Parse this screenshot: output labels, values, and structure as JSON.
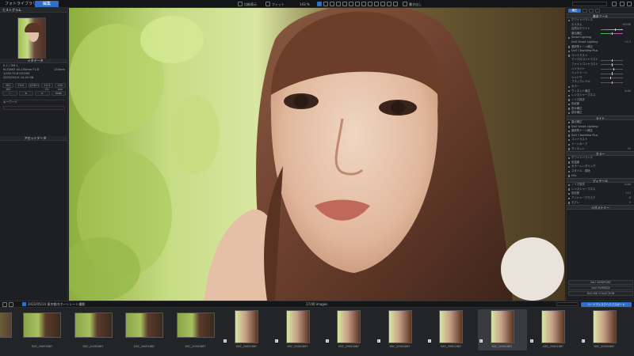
{
  "tabs": {
    "photolibrary": "フォトライブラリ",
    "edit": "編集"
  },
  "toolbar": {
    "compare": "比較表示",
    "fit": "フィット",
    "zoom": "143 %",
    "export": "書き出し"
  },
  "left_panel": {
    "histogram_title": "ヒストグラム",
    "metadata_title": "メタデータ",
    "camera": "E-1 / OM-1",
    "lens": "M.ZUIKO 40-150mm F2.8",
    "lens_right": "150mm",
    "shoot_info": "1/250 F2.8 ISO200",
    "date": "2022/05/14 14:42:38",
    "buttons": [
      "ISO 100",
      "F4.0",
      "1/250 s",
      "+0.3 EV",
      "150 mm"
    ],
    "rating_buttons": [
      "☆",
      "★",
      "✕",
      "Undo"
    ],
    "keywords_title": "キーワード",
    "assets_title": "アセットデータ"
  },
  "right_panel": {
    "tab": "補正",
    "section1": "基本ツール",
    "rows1": [
      "ホワイトバランス",
      "カスタム",
      "自然なホワイト",
      "露出補正",
      "Smart Lighting",
      "DxO Smart Lighting",
      "選択的トーン補正",
      "DxO ClearView Plus",
      "コントラスト",
      "マイクロコントラスト",
      "ファインコントラスト",
      "ハイライト",
      "ミッドトーン",
      "シャドウ",
      "ブラックレベル"
    ],
    "rows2": [
      "カラー",
      "ヴィネット補正",
      "レンズシャープネス",
      "ノイズ除去",
      "色収差",
      "歪み補正",
      "部分補正"
    ],
    "section2": "ライト",
    "rows3": [
      "露出補正",
      "DxO Smart Lighting",
      "選択的トーン補正",
      "DxO ClearView Plus",
      "コントラスト",
      "トーンカーブ",
      "ヴィネット"
    ],
    "section3": "カラー",
    "rows4": [
      "ホワイトバランス",
      "色温度",
      "カラーレンダリング",
      "スタイル - 調色",
      "HSL"
    ],
    "section4": "ディテール",
    "rows5": [
      "ノイズ除去",
      "レンズシャープネス",
      "色収差",
      "アンシャープマスク",
      "モアレ"
    ],
    "section5": "ジオメトリー",
    "bottom_buttons": [
      "DxO VIEWPOINT",
      "DxO FILMPACK",
      "DxO NIK COLLECTION"
    ],
    "values": [
      "5500K",
      "+0.3",
      "Auto",
      "50",
      "+12",
      "-8",
      "0",
      "0",
      "Auto"
    ]
  },
  "stripbar": {
    "path": "2022/05/14 東京都内ポートレート撮影",
    "count": "17/40 images",
    "export_btn": "ハードディスクへエクスポート"
  },
  "filmstrip": [
    {
      "name": "DSC_20001867",
      "portrait": false
    },
    {
      "name": "DSC_20001867",
      "portrait": false
    },
    {
      "name": "DSC_20001867",
      "portrait": false
    },
    {
      "name": "DSC_20001867",
      "portrait": false
    },
    {
      "name": "DSC_20001867",
      "portrait": true
    },
    {
      "name": "DSC_20001867",
      "portrait": true
    },
    {
      "name": "DSC_20001867",
      "portrait": true
    },
    {
      "name": "DSC_20001867",
      "portrait": true
    },
    {
      "name": "DSC_20001867",
      "portrait": true
    },
    {
      "name": "DSC_20001867",
      "portrait": true
    },
    {
      "name": "DSC_20001867",
      "portrait": true
    },
    {
      "name": "DSC_20001867",
      "portrait": true
    }
  ],
  "colors": {
    "accent": "#2f6fc7",
    "panel": "#1e1f22"
  }
}
